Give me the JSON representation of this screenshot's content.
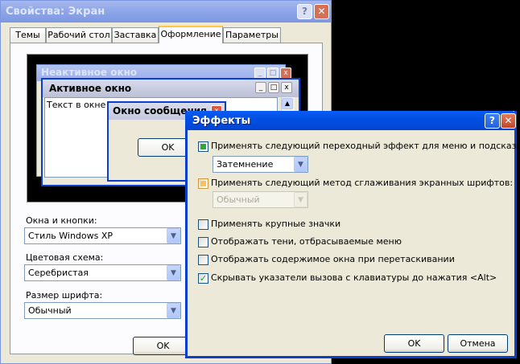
{
  "main_window": {
    "title": "Свойства: Экран",
    "help_label": "?",
    "close_label": "✕",
    "tabs": [
      "Темы",
      "Рабочий стол",
      "Заставка",
      "Оформление",
      "Параметры"
    ],
    "active_tab": "Оформление",
    "preview": {
      "inactive_title": "Неактивное окно",
      "active_title": "Активное окно",
      "window_text": "Текст в окне",
      "message_title": "Окно сообщения",
      "ok_label": "OK"
    },
    "windows_buttons": {
      "label": "Окна и кнопки:",
      "value": "Стиль Windows XP"
    },
    "color_scheme": {
      "label": "Цветовая схема:",
      "value": "Серебристая"
    },
    "font_size": {
      "label": "Размер шрифта:",
      "value": "Обычный"
    },
    "ok_label": "OK"
  },
  "effects_dialog": {
    "title": "Эффекты",
    "help_label": "?",
    "close_label": "✕",
    "transition": {
      "label": "Применять следующий переходный эффект для меню и подсказок:",
      "state": "indeterminate",
      "value": "Затемнение"
    },
    "smoothing": {
      "label": "Применять следующий метод сглаживания экранных шрифтов:",
      "state": "indeterminate",
      "value": "Обычный",
      "disabled": true
    },
    "options": [
      {
        "label": "Применять крупные значки",
        "checked": false
      },
      {
        "label": "Отображать тени, отбрасываемые меню",
        "checked": false
      },
      {
        "label": "Отображать содержимое окна при перетаскивании",
        "checked": false
      },
      {
        "label": "Скрывать указатели вызова с клавиатуры до нажатия <Alt>",
        "checked": true
      }
    ],
    "ok_label": "OK",
    "cancel_label": "Отмена"
  }
}
